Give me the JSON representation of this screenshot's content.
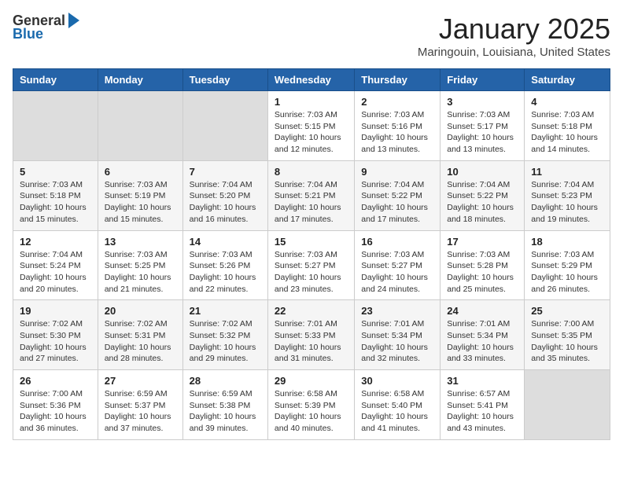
{
  "header": {
    "logo_general": "General",
    "logo_blue": "Blue",
    "title": "January 2025",
    "subtitle": "Maringouin, Louisiana, United States"
  },
  "days_of_week": [
    "Sunday",
    "Monday",
    "Tuesday",
    "Wednesday",
    "Thursday",
    "Friday",
    "Saturday"
  ],
  "weeks": [
    {
      "days": [
        {
          "num": "",
          "empty": true
        },
        {
          "num": "",
          "empty": true
        },
        {
          "num": "",
          "empty": true
        },
        {
          "num": "1",
          "sunrise": "7:03 AM",
          "sunset": "5:15 PM",
          "daylight": "10 hours and 12 minutes."
        },
        {
          "num": "2",
          "sunrise": "7:03 AM",
          "sunset": "5:16 PM",
          "daylight": "10 hours and 13 minutes."
        },
        {
          "num": "3",
          "sunrise": "7:03 AM",
          "sunset": "5:17 PM",
          "daylight": "10 hours and 13 minutes."
        },
        {
          "num": "4",
          "sunrise": "7:03 AM",
          "sunset": "5:18 PM",
          "daylight": "10 hours and 14 minutes."
        }
      ]
    },
    {
      "days": [
        {
          "num": "5",
          "sunrise": "7:03 AM",
          "sunset": "5:18 PM",
          "daylight": "10 hours and 15 minutes."
        },
        {
          "num": "6",
          "sunrise": "7:03 AM",
          "sunset": "5:19 PM",
          "daylight": "10 hours and 15 minutes."
        },
        {
          "num": "7",
          "sunrise": "7:04 AM",
          "sunset": "5:20 PM",
          "daylight": "10 hours and 16 minutes."
        },
        {
          "num": "8",
          "sunrise": "7:04 AM",
          "sunset": "5:21 PM",
          "daylight": "10 hours and 17 minutes."
        },
        {
          "num": "9",
          "sunrise": "7:04 AM",
          "sunset": "5:22 PM",
          "daylight": "10 hours and 17 minutes."
        },
        {
          "num": "10",
          "sunrise": "7:04 AM",
          "sunset": "5:22 PM",
          "daylight": "10 hours and 18 minutes."
        },
        {
          "num": "11",
          "sunrise": "7:04 AM",
          "sunset": "5:23 PM",
          "daylight": "10 hours and 19 minutes."
        }
      ]
    },
    {
      "days": [
        {
          "num": "12",
          "sunrise": "7:04 AM",
          "sunset": "5:24 PM",
          "daylight": "10 hours and 20 minutes."
        },
        {
          "num": "13",
          "sunrise": "7:03 AM",
          "sunset": "5:25 PM",
          "daylight": "10 hours and 21 minutes."
        },
        {
          "num": "14",
          "sunrise": "7:03 AM",
          "sunset": "5:26 PM",
          "daylight": "10 hours and 22 minutes."
        },
        {
          "num": "15",
          "sunrise": "7:03 AM",
          "sunset": "5:27 PM",
          "daylight": "10 hours and 23 minutes."
        },
        {
          "num": "16",
          "sunrise": "7:03 AM",
          "sunset": "5:27 PM",
          "daylight": "10 hours and 24 minutes."
        },
        {
          "num": "17",
          "sunrise": "7:03 AM",
          "sunset": "5:28 PM",
          "daylight": "10 hours and 25 minutes."
        },
        {
          "num": "18",
          "sunrise": "7:03 AM",
          "sunset": "5:29 PM",
          "daylight": "10 hours and 26 minutes."
        }
      ]
    },
    {
      "days": [
        {
          "num": "19",
          "sunrise": "7:02 AM",
          "sunset": "5:30 PM",
          "daylight": "10 hours and 27 minutes."
        },
        {
          "num": "20",
          "sunrise": "7:02 AM",
          "sunset": "5:31 PM",
          "daylight": "10 hours and 28 minutes."
        },
        {
          "num": "21",
          "sunrise": "7:02 AM",
          "sunset": "5:32 PM",
          "daylight": "10 hours and 29 minutes."
        },
        {
          "num": "22",
          "sunrise": "7:01 AM",
          "sunset": "5:33 PM",
          "daylight": "10 hours and 31 minutes."
        },
        {
          "num": "23",
          "sunrise": "7:01 AM",
          "sunset": "5:34 PM",
          "daylight": "10 hours and 32 minutes."
        },
        {
          "num": "24",
          "sunrise": "7:01 AM",
          "sunset": "5:34 PM",
          "daylight": "10 hours and 33 minutes."
        },
        {
          "num": "25",
          "sunrise": "7:00 AM",
          "sunset": "5:35 PM",
          "daylight": "10 hours and 35 minutes."
        }
      ]
    },
    {
      "days": [
        {
          "num": "26",
          "sunrise": "7:00 AM",
          "sunset": "5:36 PM",
          "daylight": "10 hours and 36 minutes."
        },
        {
          "num": "27",
          "sunrise": "6:59 AM",
          "sunset": "5:37 PM",
          "daylight": "10 hours and 37 minutes."
        },
        {
          "num": "28",
          "sunrise": "6:59 AM",
          "sunset": "5:38 PM",
          "daylight": "10 hours and 39 minutes."
        },
        {
          "num": "29",
          "sunrise": "6:58 AM",
          "sunset": "5:39 PM",
          "daylight": "10 hours and 40 minutes."
        },
        {
          "num": "30",
          "sunrise": "6:58 AM",
          "sunset": "5:40 PM",
          "daylight": "10 hours and 41 minutes."
        },
        {
          "num": "31",
          "sunrise": "6:57 AM",
          "sunset": "5:41 PM",
          "daylight": "10 hours and 43 minutes."
        },
        {
          "num": "",
          "empty": true
        }
      ]
    }
  ],
  "labels": {
    "sunrise": "Sunrise:",
    "sunset": "Sunset:",
    "daylight": "Daylight:"
  }
}
